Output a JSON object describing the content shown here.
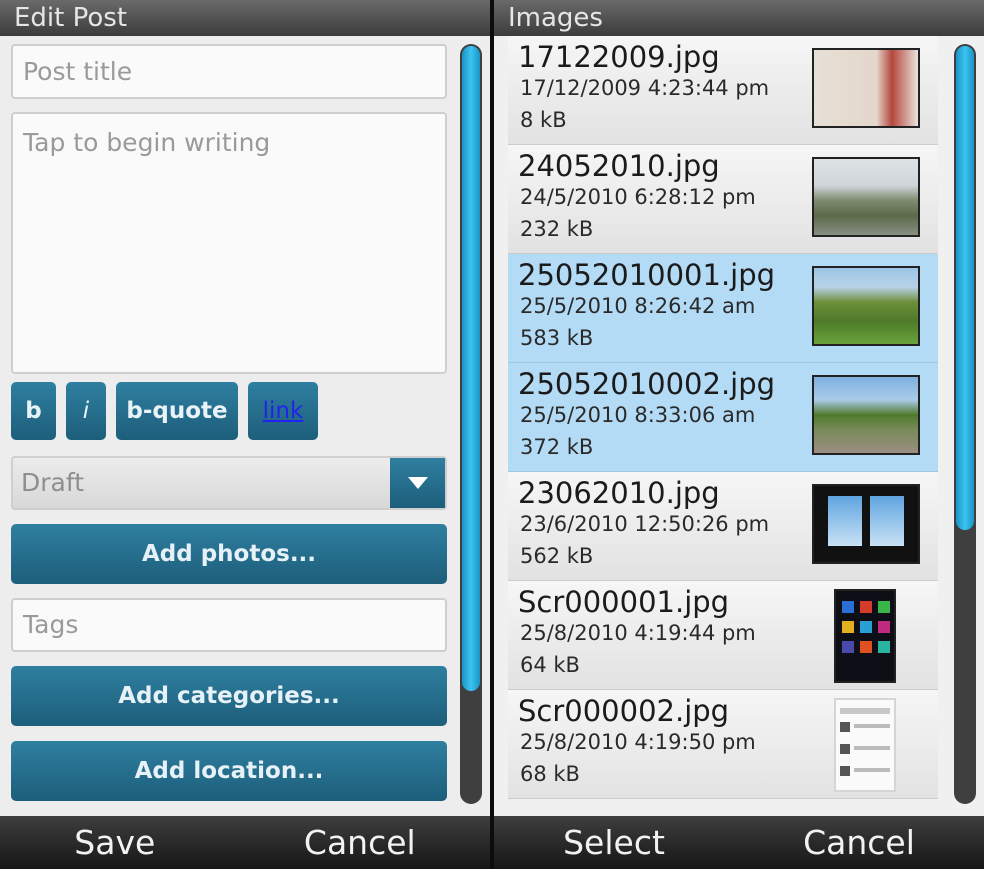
{
  "left": {
    "title": "Edit Post",
    "post_title_placeholder": "Post title",
    "body_placeholder": "Tap to begin writing",
    "format_buttons": {
      "bold": "b",
      "italic": "i",
      "bquote": "b-quote",
      "link": "link"
    },
    "status_value": "Draft",
    "add_photos_label": "Add photos...",
    "tags_placeholder": "Tags",
    "add_categories_label": "Add categories...",
    "add_location_label": "Add location...",
    "softkey_left": "Save",
    "softkey_right": "Cancel",
    "scroll_fraction": 0.85
  },
  "right": {
    "title": "Images",
    "items": [
      {
        "name": "17122009.jpg",
        "date": "17/12/2009 4:23:44 pm",
        "size": "8 kB",
        "selected": false
      },
      {
        "name": "24052010.jpg",
        "date": "24/5/2010 6:28:12 pm",
        "size": "232 kB",
        "selected": false
      },
      {
        "name": "25052010001.jpg",
        "date": "25/5/2010 8:26:42 am",
        "size": "583 kB",
        "selected": true
      },
      {
        "name": "25052010002.jpg",
        "date": "25/5/2010 8:33:06 am",
        "size": "372 kB",
        "selected": true
      },
      {
        "name": "23062010.jpg",
        "date": "23/6/2010 12:50:26 pm",
        "size": "562 kB",
        "selected": false
      },
      {
        "name": "Scr000001.jpg",
        "date": "25/8/2010 4:19:44 pm",
        "size": "64 kB",
        "selected": false
      },
      {
        "name": "Scr000002.jpg",
        "date": "25/8/2010 4:19:50 pm",
        "size": "68 kB",
        "selected": false
      }
    ],
    "softkey_left": "Select",
    "softkey_right": "Cancel",
    "scroll_fraction": 0.64
  },
  "colors": {
    "accent": "#1d5e7b",
    "scroll_thumb": "#3cc4ef",
    "selection": "#b4dbf5"
  }
}
